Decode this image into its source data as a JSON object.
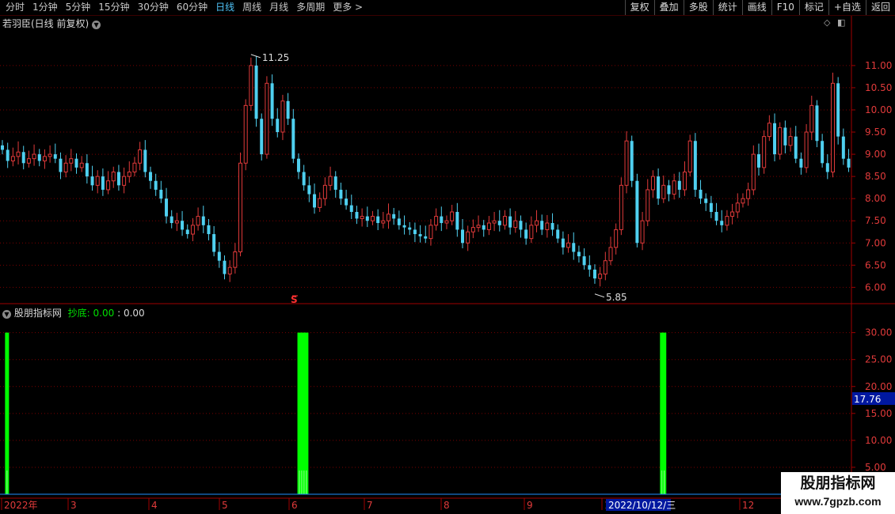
{
  "toolbar": {
    "periods": [
      "分时",
      "1分钟",
      "5分钟",
      "15分钟",
      "30分钟",
      "60分钟",
      "日线",
      "周线",
      "月线",
      "多周期",
      "更多 >"
    ],
    "active_period": "日线",
    "tools": [
      "复权",
      "叠加",
      "多股",
      "统计",
      "画线",
      "F10",
      "标记",
      "+自选",
      "返回"
    ]
  },
  "main_pane": {
    "title": "若羽臣(日线 前复权)",
    "icons": [
      "diamond-icon",
      "panel-toggle-icon"
    ],
    "high_label": "11.25",
    "low_label": "5.85",
    "signal_marker": "S"
  },
  "indicator_pane": {
    "name": "股朋指标网",
    "label": "抄底:",
    "value1": "0.00",
    "value2": ": 0.00",
    "current_tag": "17.76"
  },
  "x_axis": {
    "labels": [
      "2022年",
      "3",
      "4",
      "5",
      "6",
      "7",
      "8",
      "9",
      "1",
      "12"
    ],
    "cursor_date": "2022/10/12/三"
  },
  "watermark": {
    "title": "股朋指标网",
    "url": "www.7gpzb.com"
  },
  "colors": {
    "up": "#e03a3a",
    "down": "#4fd0f0",
    "signal": "#00ff00",
    "axis": "#a00000",
    "tag_bg": "#0018a0"
  },
  "chart_data": [
    {
      "type": "candlestick",
      "title": "若羽臣(日线 前复权)",
      "y_ticks": [
        "6.00",
        "6.50",
        "7.00",
        "7.50",
        "8.00",
        "8.50",
        "9.00",
        "9.50",
        "10.00",
        "10.50",
        "11.00"
      ],
      "ylim": [
        5.65,
        11.8
      ],
      "annotations": [
        {
          "label": "11.25",
          "type": "high"
        },
        {
          "label": "5.85",
          "type": "low"
        }
      ],
      "close": [
        9.1,
        8.85,
        8.95,
        9.05,
        8.8,
        8.9,
        9.0,
        8.85,
        8.95,
        9.0,
        8.9,
        8.6,
        8.8,
        8.9,
        8.7,
        8.8,
        8.5,
        8.3,
        8.5,
        8.2,
        8.4,
        8.6,
        8.3,
        8.5,
        8.6,
        8.8,
        9.1,
        8.6,
        8.4,
        8.2,
        8.0,
        7.6,
        7.45,
        7.5,
        7.3,
        7.2,
        7.4,
        7.6,
        7.4,
        7.2,
        6.8,
        6.6,
        6.3,
        6.45,
        6.8,
        8.8,
        10.1,
        11.0,
        9.8,
        9.0,
        10.6,
        9.8,
        9.5,
        10.2,
        9.8,
        8.9,
        8.6,
        8.3,
        8.1,
        7.8,
        8.0,
        8.3,
        8.5,
        8.2,
        8.0,
        7.85,
        7.7,
        7.55,
        7.6,
        7.5,
        7.6,
        7.45,
        7.5,
        7.65,
        7.55,
        7.4,
        7.35,
        7.3,
        7.2,
        7.15,
        7.1,
        7.4,
        7.6,
        7.45,
        7.5,
        7.7,
        7.3,
        7.0,
        7.25,
        7.35,
        7.4,
        7.3,
        7.45,
        7.5,
        7.4,
        7.6,
        7.35,
        7.5,
        7.3,
        7.1,
        7.4,
        7.5,
        7.3,
        7.45,
        7.3,
        7.1,
        6.9,
        7.0,
        6.8,
        6.7,
        6.5,
        6.4,
        6.2,
        6.3,
        6.6,
        6.9,
        7.3,
        8.3,
        9.3,
        8.4,
        7.0,
        7.5,
        8.2,
        8.5,
        8.0,
        8.3,
        8.1,
        8.4,
        8.2,
        8.6,
        9.3,
        8.2,
        8.0,
        7.9,
        7.7,
        7.5,
        7.4,
        7.6,
        7.7,
        7.9,
        8.0,
        8.2,
        9.0,
        8.7,
        9.4,
        9.7,
        9.0,
        9.6,
        9.2,
        9.4,
        8.9,
        8.7,
        9.5,
        10.1,
        9.3,
        8.8,
        8.6,
        10.6,
        9.4,
        8.9,
        8.7
      ]
    },
    {
      "type": "bar",
      "title": "股朋指标网",
      "series": [
        {
          "name": "抄底",
          "values": [
            30,
            0,
            30,
            30,
            30,
            30,
            30,
            30
          ]
        }
      ],
      "y_ticks": [
        "5.00",
        "10.00",
        "15.00",
        "20.00",
        "25.00",
        "30.00"
      ],
      "ylim": [
        0,
        32
      ],
      "signal_dates": [
        "2022-01-04",
        "2022-04-26",
        "2022-05-09",
        "2022-05-10",
        "2022-05-11",
        "2022-05-12",
        "2022-10-11",
        "2022-10-12"
      ]
    }
  ]
}
